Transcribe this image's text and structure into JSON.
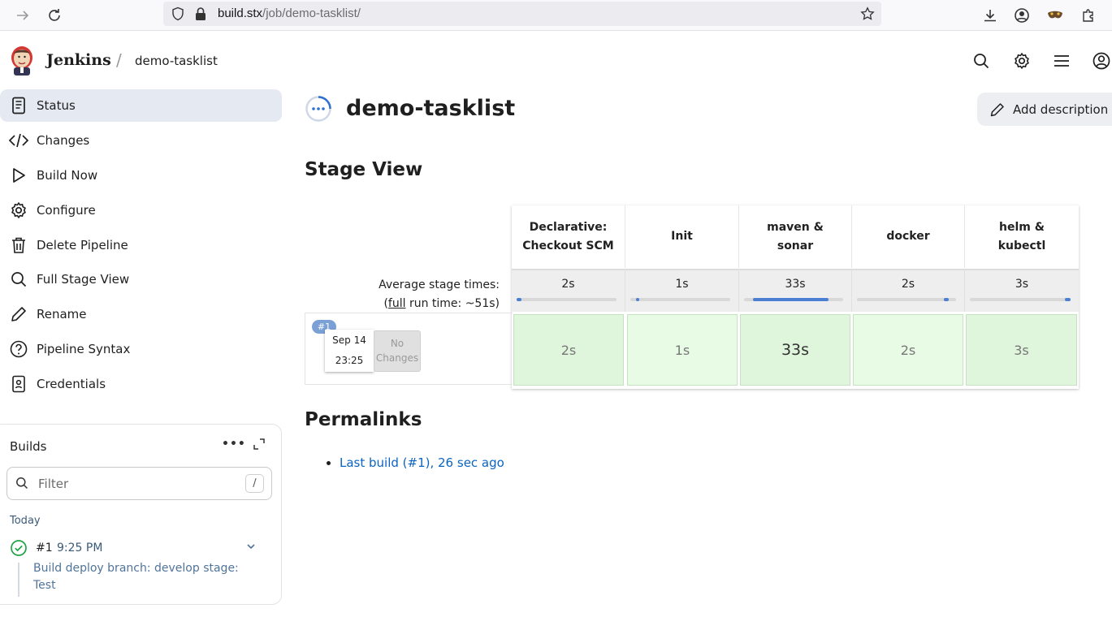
{
  "browser": {
    "url_host": "build.stx",
    "url_path": "/job/demo-tasklist/"
  },
  "header": {
    "brand": "Jenkins",
    "separator": "/",
    "breadcrumb": "demo-tasklist"
  },
  "sidebar": {
    "items": [
      {
        "label": "Status",
        "icon": "document-icon",
        "active": true
      },
      {
        "label": "Changes",
        "icon": "code-icon"
      },
      {
        "label": "Build Now",
        "icon": "play-icon"
      },
      {
        "label": "Configure",
        "icon": "gear-icon"
      },
      {
        "label": "Delete Pipeline",
        "icon": "trash-icon"
      },
      {
        "label": "Full Stage View",
        "icon": "search-icon"
      },
      {
        "label": "Rename",
        "icon": "pencil-icon"
      },
      {
        "label": "Pipeline Syntax",
        "icon": "help-icon"
      },
      {
        "label": "Credentials",
        "icon": "badge-icon"
      }
    ]
  },
  "builds": {
    "title": "Builds",
    "more": "•••",
    "filter_placeholder": "Filter",
    "filter_shortcut": "/",
    "group": "Today",
    "entries": [
      {
        "number": "#1",
        "time": "9:25 PM",
        "description": "Build deploy branch: develop stage: Test",
        "status": "success"
      }
    ]
  },
  "main": {
    "title": "demo-tasklist",
    "add_description": "Add description",
    "stage_view_heading": "Stage View",
    "permalinks_heading": "Permalinks",
    "permalinks": [
      "Last build (#1), 26 sec ago"
    ]
  },
  "stage_view": {
    "avg_label_line1": "Average stage times:",
    "avg_label_open": "(",
    "avg_label_full": "full",
    "avg_label_rest": " run time: ~51s)",
    "stages": [
      {
        "name": "Declarative: Checkout SCM",
        "avg": "2s",
        "fill_start": 0.0,
        "fill_end": 0.05
      },
      {
        "name": "Init",
        "avg": "1s",
        "fill_start": 0.06,
        "fill_end": 0.09
      },
      {
        "name": "maven & sonar",
        "avg": "33s",
        "fill_start": 0.09,
        "fill_end": 0.85
      },
      {
        "name": "docker",
        "avg": "2s",
        "fill_start": 0.88,
        "fill_end": 0.93
      },
      {
        "name": "helm & kubectl",
        "avg": "3s",
        "fill_start": 0.94,
        "fill_end": 1.0
      }
    ],
    "run": {
      "badge": "#1",
      "date": "Sep 14",
      "time": "23:25",
      "no_changes": "No Changes",
      "durations": [
        "2s",
        "1s",
        "33s",
        "2s",
        "3s"
      ]
    }
  },
  "colors": {
    "accent": "#0b64c0",
    "success": "#1ea446",
    "stage_success_bg": "#dff5dc",
    "progress_fill": "#4a7fd4"
  }
}
